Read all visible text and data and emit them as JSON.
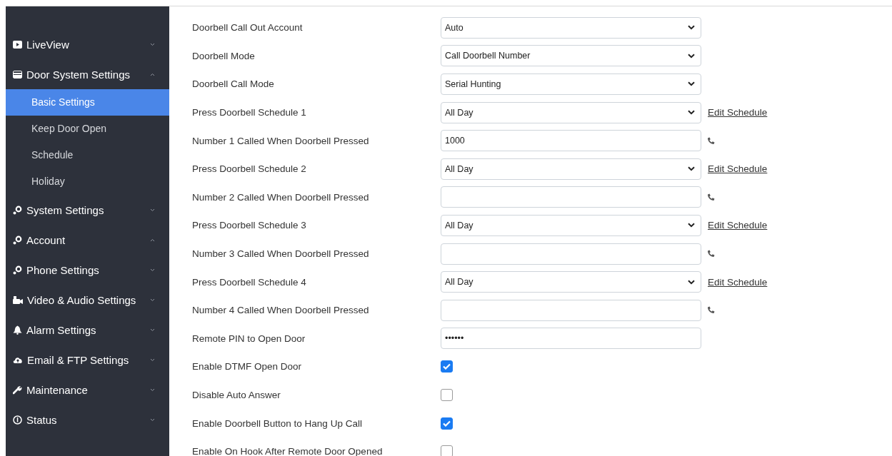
{
  "sidebar": {
    "items": [
      {
        "label": "LiveView",
        "expanded": false
      },
      {
        "label": "Door System Settings",
        "expanded": true,
        "children": [
          {
            "label": "Basic Settings",
            "selected": true
          },
          {
            "label": "Keep Door Open",
            "selected": false
          },
          {
            "label": "Schedule",
            "selected": false
          },
          {
            "label": "Holiday",
            "selected": false
          }
        ]
      },
      {
        "label": "System Settings",
        "expanded": false
      },
      {
        "label": "Account",
        "expanded": true
      },
      {
        "label": "Phone Settings",
        "expanded": false
      },
      {
        "label": "Video & Audio Settings",
        "expanded": false
      },
      {
        "label": "Alarm Settings",
        "expanded": false
      },
      {
        "label": "Email & FTP Settings",
        "expanded": false
      },
      {
        "label": "Maintenance",
        "expanded": false
      },
      {
        "label": "Status",
        "expanded": false
      }
    ]
  },
  "settings": [
    {
      "kind": "select",
      "label": "Doorbell Call Out Account",
      "value": "Auto"
    },
    {
      "kind": "select",
      "label": "Doorbell Mode",
      "value": "Call Doorbell Number"
    },
    {
      "kind": "select",
      "label": "Doorbell Call Mode",
      "value": "Serial Hunting"
    },
    {
      "kind": "select",
      "label": "Press Doorbell Schedule 1",
      "value": "All Day",
      "link": "Edit Schedule"
    },
    {
      "kind": "phone",
      "label": "Number 1 Called When Doorbell Pressed",
      "value": "1000"
    },
    {
      "kind": "select",
      "label": "Press Doorbell Schedule 2",
      "value": "All Day",
      "link": "Edit Schedule"
    },
    {
      "kind": "phone",
      "label": "Number 2 Called When Doorbell Pressed"
    },
    {
      "kind": "select",
      "label": "Press Doorbell Schedule 3",
      "value": "All Day",
      "link": "Edit Schedule"
    },
    {
      "kind": "phone",
      "label": "Number 3 Called When Doorbell Pressed"
    },
    {
      "kind": "select",
      "label": "Press Doorbell Schedule 4",
      "value": "All Day",
      "link": "Edit Schedule"
    },
    {
      "kind": "phone",
      "label": "Number 4 Called When Doorbell Pressed"
    },
    {
      "kind": "password",
      "label": "Remote PIN to Open Door",
      "value": "••••••"
    },
    {
      "kind": "checkbox",
      "label": "Enable DTMF Open Door",
      "checked": true
    },
    {
      "kind": "checkbox",
      "label": "Disable Auto Answer",
      "checked": false
    },
    {
      "kind": "checkbox",
      "label": "Enable Doorbell Button to Hang Up Call",
      "checked": true
    },
    {
      "kind": "checkbox",
      "label": "Enable On Hook After Remote Door Opened",
      "checked": false
    }
  ]
}
